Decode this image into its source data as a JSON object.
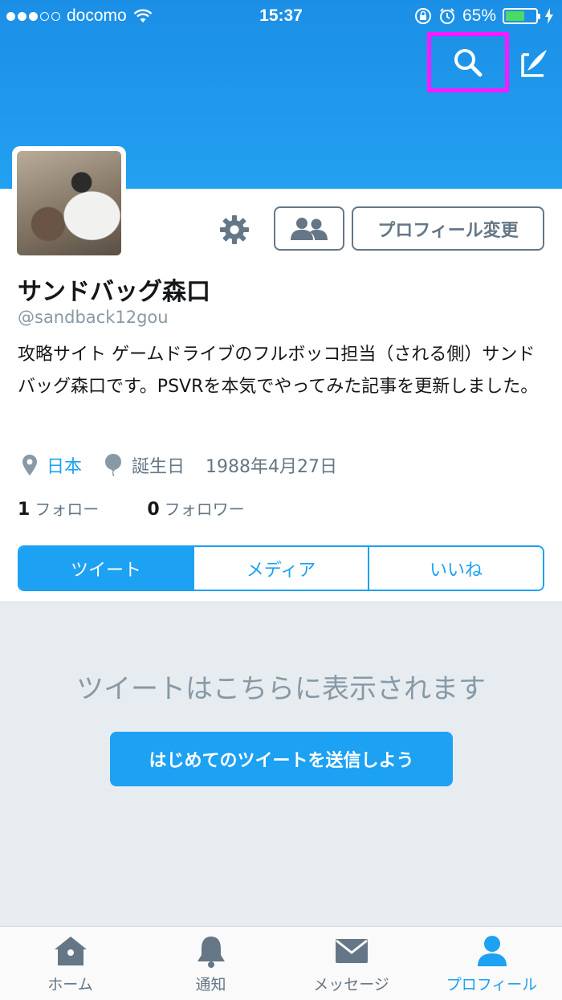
{
  "status_bar": {
    "carrier": "docomo",
    "time": "15:37",
    "battery": "65%",
    "battery_level": 0.65
  },
  "header": {
    "search_icon": "search-icon",
    "compose_icon": "compose-icon"
  },
  "profile": {
    "name": "サンドバッグ森口",
    "handle": "@sandback12gou",
    "bio": "攻略サイト ゲームドライブのフルボッコ担当（される側）サンドバッグ森口です。PSVRを本気でやってみた記事を更新しました。",
    "location": "日本",
    "birthday_label": "誕生日",
    "birthday": "1988年4月27日",
    "following_count": "1",
    "following_label": "フォロー",
    "followers_count": "0",
    "followers_label": "フォロワー",
    "edit_button": "プロフィール変更"
  },
  "tabs": [
    {
      "label": "ツイート",
      "active": true
    },
    {
      "label": "メディア",
      "active": false
    },
    {
      "label": "いいね",
      "active": false
    }
  ],
  "empty_state": {
    "message": "ツイートはこちらに表示されます",
    "button": "はじめてのツイートを送信しよう"
  },
  "bottom_nav": [
    {
      "label": "ホーム",
      "icon": "home-icon"
    },
    {
      "label": "通知",
      "icon": "bell-icon"
    },
    {
      "label": "メッセージ",
      "icon": "envelope-icon"
    },
    {
      "label": "プロフィール",
      "icon": "person-icon",
      "active": true
    }
  ],
  "colors": {
    "accent": "#1da1f2",
    "highlight_box": "#ff19ff"
  }
}
